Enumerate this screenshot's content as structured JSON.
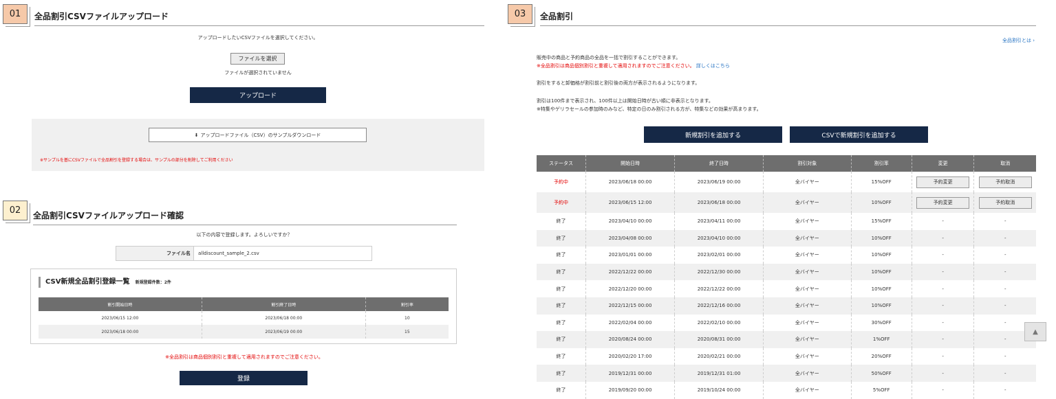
{
  "s1": {
    "badge": "01",
    "title": "全品割引CSVファイルアップロード",
    "instruction": "アップロードしたいCSVファイルを選択してください。",
    "choose_file": "ファイルを選択",
    "no_file": "ファイルが選択されていません",
    "upload": "アップロード",
    "sample_download": "アップロードファイル（CSV）のサンプルダウンロード",
    "note": "※サンプルを基にCSVファイルで全品割引を登録する場合は、サンプルの部分を削除してご利用ください"
  },
  "s2": {
    "badge": "02",
    "title": "全品割引CSVファイルアップロード確認",
    "confirm": "以下の内容で登録します。よろしいですか？",
    "file_label": "ファイル名",
    "file_value": "alldiscount_sample_2.csv",
    "list_title": "CSV新規全品割引登録一覧",
    "list_count": "新規登録件数：2件",
    "headers": [
      "割引開始日時",
      "割引終了日時",
      "割引率"
    ],
    "rows": [
      [
        "2023/06/15 12:00",
        "2023/06/18 00:00",
        "10"
      ],
      [
        "2023/06/18 00:00",
        "2023/06/19 00:00",
        "15"
      ]
    ],
    "warning": "※全品割引は商品個別割引と重複して適用されますのでご注意ください。",
    "register": "登録"
  },
  "s3": {
    "badge": "03",
    "title": "全品割引",
    "help_link": "全品割引とは ›",
    "line1": "販売中の商品と予約商品の全品を一括で割引することができます。",
    "warning": "※全品割引は商品個別割引と重複して適用されますのでご注意ください。",
    "detail_link": "詳しくはこちら",
    "line2": "割引をすると卸価格が割引前と割引後の両方が表示されるようになります。",
    "line3": "割引は100件まで表示され、100件以上は開始日時が古い順に非表示となります。",
    "line4": "※特集やゲリラセールの参加時のみなど、特定の日のみ割引される方が、特集などの効果が高まります。",
    "add_btn": "新規割引を追加する",
    "csv_btn": "CSVで新規割引を追加する",
    "headers": [
      "ステータス",
      "開始日時",
      "終了日時",
      "割引対象",
      "割引率",
      "変更",
      "取消"
    ],
    "change_btn": "予約変更",
    "cancel_btn": "予約取消",
    "rows": [
      [
        "予約中",
        "2023/06/18 00:00",
        "2023/06/19 00:00",
        "全バイヤー",
        "15%OFF",
        "予約変更",
        "予約取消"
      ],
      [
        "予約中",
        "2023/06/15 12:00",
        "2023/06/18 00:00",
        "全バイヤー",
        "10%OFF",
        "予約変更",
        "予約取消"
      ],
      [
        "終了",
        "2023/04/10 00:00",
        "2023/04/11 00:00",
        "全バイヤー",
        "15%OFF",
        "-",
        "-"
      ],
      [
        "終了",
        "2023/04/08 00:00",
        "2023/04/10 00:00",
        "全バイヤー",
        "10%OFF",
        "-",
        "-"
      ],
      [
        "終了",
        "2023/01/01 00:00",
        "2023/02/01 00:00",
        "全バイヤー",
        "10%OFF",
        "-",
        "-"
      ],
      [
        "終了",
        "2022/12/22 00:00",
        "2022/12/30 00:00",
        "全バイヤー",
        "10%OFF",
        "-",
        "-"
      ],
      [
        "終了",
        "2022/12/20 00:00",
        "2022/12/22 00:00",
        "全バイヤー",
        "10%OFF",
        "-",
        "-"
      ],
      [
        "終了",
        "2022/12/15 00:00",
        "2022/12/16 00:00",
        "全バイヤー",
        "10%OFF",
        "-",
        "-"
      ],
      [
        "終了",
        "2022/02/04 00:00",
        "2022/02/10 00:00",
        "全バイヤー",
        "30%OFF",
        "-",
        "-"
      ],
      [
        "終了",
        "2020/08/24 00:00",
        "2020/08/31 00:00",
        "全バイヤー",
        "1%OFF",
        "-",
        "-"
      ],
      [
        "終了",
        "2020/02/20 17:00",
        "2020/02/21 00:00",
        "全バイヤー",
        "20%OFF",
        "-",
        "-"
      ],
      [
        "終了",
        "2019/12/31 00:00",
        "2019/12/31 01:00",
        "全バイヤー",
        "50%OFF",
        "-",
        "-"
      ],
      [
        "終了",
        "2019/09/20 00:00",
        "2019/10/24 00:00",
        "全バイヤー",
        "5%OFF",
        "-",
        "-"
      ]
    ],
    "scroll_top": "▲",
    "colors": {
      "navy": "#152846",
      "status_red": "#e30000",
      "header_gray": "#6e6e6e"
    }
  }
}
